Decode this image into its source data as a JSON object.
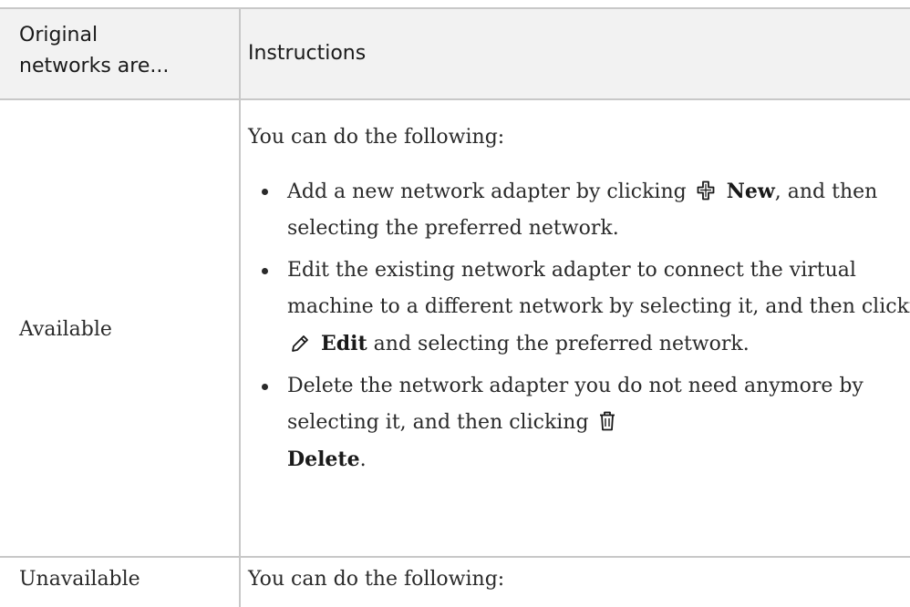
{
  "header": {
    "col1": "Original networks are...",
    "col1_line1": "Original",
    "col1_line2": "networks are...",
    "col2": "Instructions"
  },
  "rows": [
    {
      "state": "Available",
      "intro": "You can do the following:",
      "bullets": [
        {
          "before": "Add a new network adapter by clicking",
          "icon": "plus-icon",
          "action": "New",
          "after": ", and then selecting the preferred network."
        },
        {
          "before": "Edit the existing network adapter to connect the virtual machine to a different network by selecting it, and then clicking",
          "icon": "pencil-icon",
          "action": "Edit",
          "after": "and selecting the preferred network."
        },
        {
          "before": "Delete the network adapter you do not need anymore by selecting it, and then clicking",
          "icon": "trash-icon",
          "action": "Delete",
          "after": "."
        }
      ]
    },
    {
      "state": "Unavailable",
      "intro": "You can do the following:"
    }
  ]
}
